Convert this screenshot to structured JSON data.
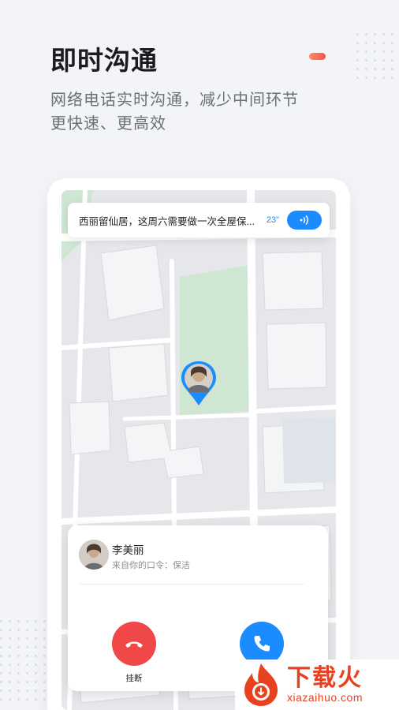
{
  "header": {
    "title": "即时沟通",
    "subtitle_line1": "网络电话实时沟通，减少中间环节",
    "subtitle_line2": "更快速、更高效"
  },
  "notice": {
    "message": "西丽留仙居，这周六需要做一次全屋保...",
    "duration": "23\""
  },
  "call": {
    "caller_name": "李美丽",
    "caller_source": "来自你的口令：保洁",
    "hangup_label": "挂断"
  },
  "watermark": {
    "title": "下载火",
    "url": "xiazaihuo.com"
  },
  "colors": {
    "accent_blue": "#1a8cff",
    "hangup_red": "#f04848",
    "brand_orange": "#e8411f",
    "background": "#f3f4f7"
  },
  "icons": {
    "voice": "sound-wave-icon",
    "hangup": "phone-hangup-icon",
    "answer": "phone-answer-icon"
  }
}
